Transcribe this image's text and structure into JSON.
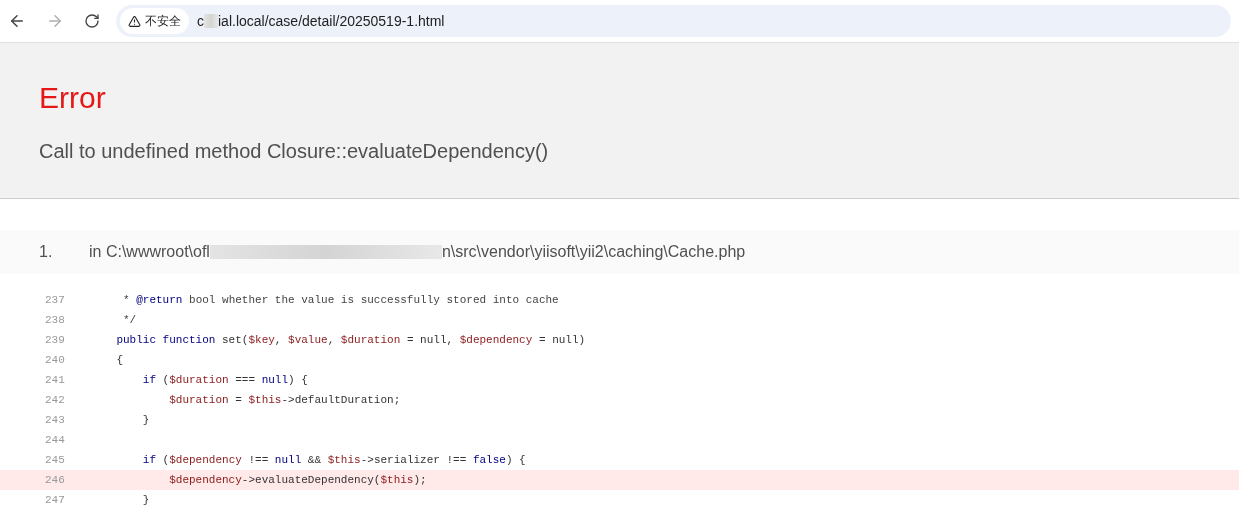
{
  "browser": {
    "security_label": "不安全",
    "url_start": "c",
    "url_end": "ial.local/case/detail/20250519-1.html"
  },
  "error": {
    "title": "Error",
    "message": "Call to undefined method Closure::evaluateDependency()"
  },
  "trace": {
    "number": "1.",
    "path_start": "in C:\\wwwroot\\ofl",
    "path_end": "n\\src\\vendor\\yiisoft\\yii2\\caching\\Cache.php"
  },
  "code_lines": [
    {
      "number": "237",
      "highlighted": false,
      "tokens": [
        {
          "kind": "comment",
          "text": "     * "
        },
        {
          "kind": "keyword",
          "text": "@return"
        },
        {
          "kind": "comment",
          "text": " bool whether the value is successfully stored into cache"
        }
      ]
    },
    {
      "number": "238",
      "highlighted": false,
      "tokens": [
        {
          "kind": "comment",
          "text": "     */"
        }
      ]
    },
    {
      "number": "239",
      "highlighted": false,
      "tokens": [
        {
          "kind": "keyword",
          "text": "    public function"
        },
        {
          "kind": "plain",
          "text": " set("
        },
        {
          "kind": "var",
          "text": "$key"
        },
        {
          "kind": "plain",
          "text": ", "
        },
        {
          "kind": "var",
          "text": "$value"
        },
        {
          "kind": "plain",
          "text": ", "
        },
        {
          "kind": "var",
          "text": "$duration"
        },
        {
          "kind": "plain",
          "text": " = null, "
        },
        {
          "kind": "var",
          "text": "$dependency"
        },
        {
          "kind": "plain",
          "text": " = null)"
        }
      ]
    },
    {
      "number": "240",
      "highlighted": false,
      "tokens": [
        {
          "kind": "plain",
          "text": "    {"
        }
      ]
    },
    {
      "number": "241",
      "highlighted": false,
      "tokens": [
        {
          "kind": "keyword",
          "text": "        if"
        },
        {
          "kind": "plain",
          "text": " ("
        },
        {
          "kind": "var",
          "text": "$duration"
        },
        {
          "kind": "plain",
          "text": " === "
        },
        {
          "kind": "keyword",
          "text": "null"
        },
        {
          "kind": "plain",
          "text": ") {"
        }
      ]
    },
    {
      "number": "242",
      "highlighted": false,
      "tokens": [
        {
          "kind": "var",
          "text": "            $duration"
        },
        {
          "kind": "plain",
          "text": " = "
        },
        {
          "kind": "var",
          "text": "$this"
        },
        {
          "kind": "plain",
          "text": "->defaultDuration;"
        }
      ]
    },
    {
      "number": "243",
      "highlighted": false,
      "tokens": [
        {
          "kind": "plain",
          "text": "        }"
        }
      ]
    },
    {
      "number": "244",
      "highlighted": false
    },
    {
      "number": "245",
      "highlighted": false,
      "tokens": [
        {
          "kind": "keyword",
          "text": "        if"
        },
        {
          "kind": "plain",
          "text": " ("
        },
        {
          "kind": "var",
          "text": "$dependency"
        },
        {
          "kind": "plain",
          "text": " !== "
        },
        {
          "kind": "keyword",
          "text": "null"
        },
        {
          "kind": "plain",
          "text": " && "
        },
        {
          "kind": "var",
          "text": "$this"
        },
        {
          "kind": "plain",
          "text": "->serializer !== "
        },
        {
          "kind": "keyword",
          "text": "false"
        },
        {
          "kind": "plain",
          "text": ") {"
        }
      ]
    },
    {
      "number": "246",
      "highlighted": true,
      "tokens": [
        {
          "kind": "var",
          "text": "            $dependency"
        },
        {
          "kind": "plain",
          "text": "->evaluateDependency("
        },
        {
          "kind": "var",
          "text": "$this"
        },
        {
          "kind": "plain",
          "text": ");"
        }
      ]
    },
    {
      "number": "247",
      "highlighted": false,
      "tokens": [
        {
          "kind": "plain",
          "text": "        }"
        }
      ]
    }
  ]
}
